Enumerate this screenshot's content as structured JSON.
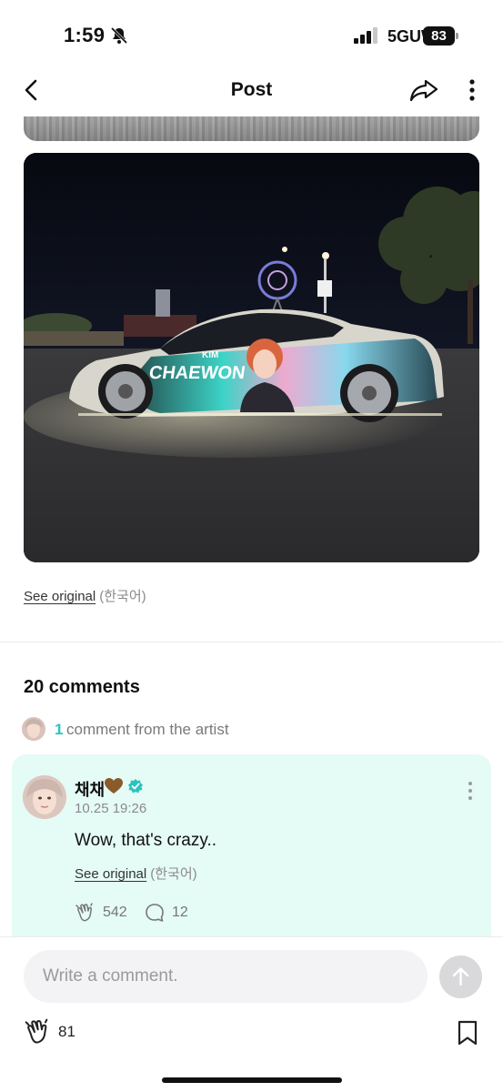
{
  "status_bar": {
    "time": "1:59",
    "network": "5GUW",
    "battery": "83",
    "icons": [
      "bell-slash-icon",
      "signal-icon"
    ]
  },
  "nav": {
    "title": "Post",
    "icons": [
      "back-icon",
      "share-icon",
      "more-vertical-icon"
    ]
  },
  "post": {
    "image_text": [
      "KIM",
      "CHAEWON"
    ],
    "see_original": "See original",
    "language": "(한국어)"
  },
  "comments": {
    "heading": "20 comments",
    "artist_count": "1",
    "artist_label": "comment from the artist"
  },
  "artist_comment": {
    "author": "채채",
    "timestamp": "10.25 19:26",
    "text": "Wow, that's crazy..",
    "see_original": "See original",
    "language": "(한국어)",
    "likes": "542",
    "replies": "12",
    "accent_color": "#2bc3c0",
    "card_color": "#e5fbf6"
  },
  "composer": {
    "placeholder": "Write a comment."
  },
  "footer": {
    "likes": "81",
    "icons": [
      "clap-icon",
      "bookmark-icon"
    ]
  }
}
